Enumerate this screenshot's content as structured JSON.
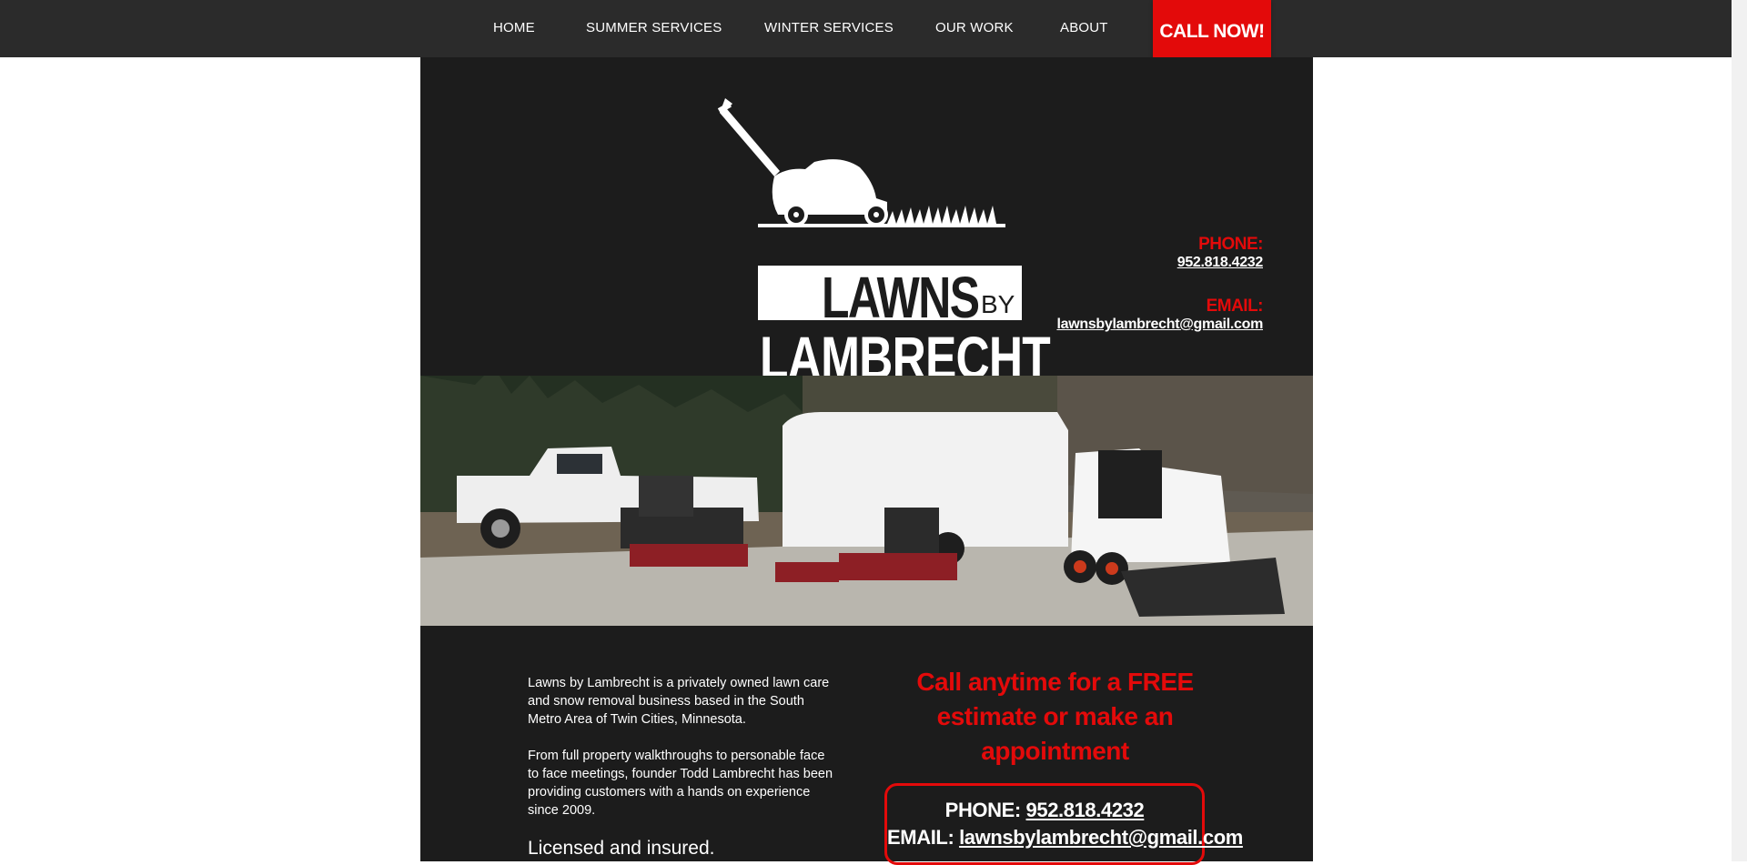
{
  "nav": {
    "items": [
      {
        "label": "HOME"
      },
      {
        "label": "SUMMER SERVICES"
      },
      {
        "label": "WINTER SERVICES"
      },
      {
        "label": "OUR WORK"
      },
      {
        "label": "ABOUT"
      }
    ],
    "call_now": "CALL NOW!"
  },
  "header": {
    "logo_lawns": "LAWNS",
    "logo_by": "BY",
    "logo_lambrecht": "LAMBRECHT",
    "phone_label": "PHONE:",
    "phone_value": "952.818.4232",
    "email_label": "EMAIL:",
    "email_value": "lawnsbylambrecht@gmail.com"
  },
  "about": {
    "paragraph1": "Lawns by Lambrecht is a privately owned lawn care and snow removal business based in the South Metro Area of Twin Cities, Minnesota.",
    "paragraph2": "From full property walkthroughs to personable face to face meetings, founder Todd Lambrecht has been providing customers with a hands on experience since 2009.",
    "licensed": "Licensed and insured."
  },
  "cta": {
    "heading": "Call anytime for a FREE estimate or make an appointment",
    "phone_label": "PHONE: ",
    "phone_value": "952.818.4232",
    "email_label": "EMAIL: ",
    "email_value": "lawnsbylambrecht@gmail.com"
  },
  "colors": {
    "accent_red": "#e30a0a",
    "nav_bg": "#2b2b2b",
    "content_bg": "#1c1c1c"
  }
}
